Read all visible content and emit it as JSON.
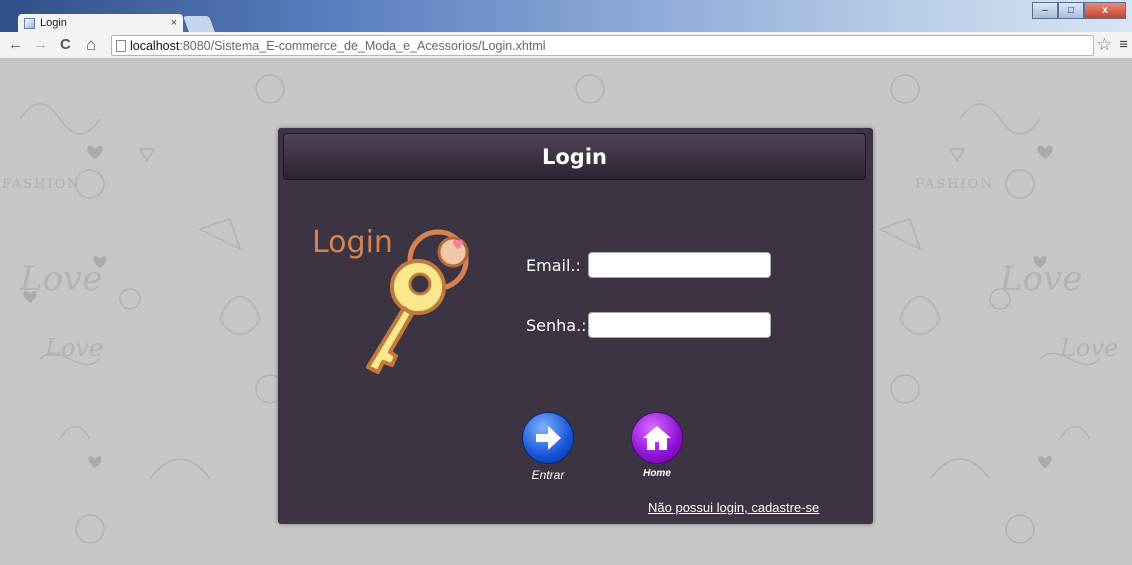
{
  "browser": {
    "tab_title": "Login",
    "tab_close": "×",
    "url_host": "localhost",
    "url_path": ":8080/Sistema_E-commerce_de_Moda_e_Acessorios/Login.xhtml",
    "back_icon": "←",
    "forward_icon": "→",
    "reload_icon": "C",
    "home_icon": "⌂",
    "star_icon": "☆",
    "menu_icon": "≡",
    "minimize": "–",
    "maximize": "□",
    "close": "x"
  },
  "panel": {
    "title": "Login",
    "logo_text": "Login",
    "email_label": "Email.:",
    "email_value": "",
    "password_label": "Senha.:",
    "password_value": "",
    "submit_label": "Entrar",
    "home_label": "Home",
    "register_link": "Não possui login, cadastre-se"
  },
  "background": {
    "words": [
      "Love",
      "FASHION",
      "Love",
      "FASHION",
      "Love",
      "Love"
    ]
  },
  "colors": {
    "panel_bg": "#3c3442",
    "header_bg": "#2c2432",
    "submit_button": "#1854d8",
    "home_button": "#8f12d6"
  }
}
